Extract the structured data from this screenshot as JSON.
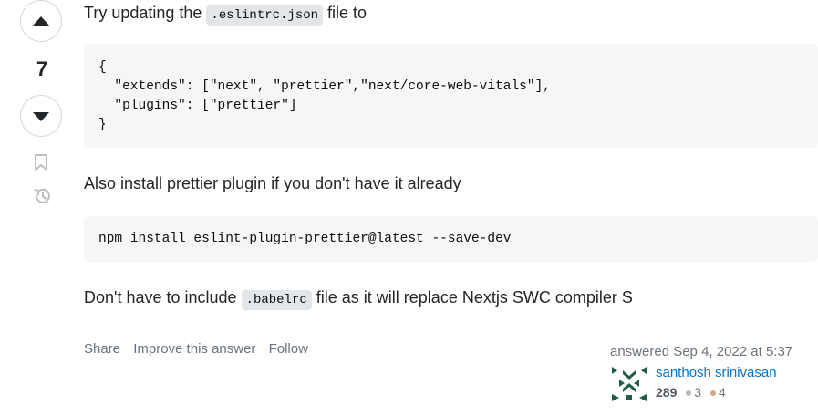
{
  "vote": {
    "count": "7",
    "up_icon": "arrow-up-icon",
    "down_icon": "arrow-down-icon",
    "bookmark_icon": "bookmark-icon",
    "history_icon": "history-icon"
  },
  "post": {
    "p1_before": "Try updating the ",
    "p1_code": ".eslintrc.json",
    "p1_after": " file to",
    "code1": "{\n  \"extends\": [\"next\", \"prettier\",\"next/core-web-vitals\"],\n  \"plugins\": [\"prettier\"]\n}",
    "p2": "Also install prettier plugin if you don't have it already",
    "code2": "npm install eslint-plugin-prettier@latest --save-dev",
    "p3_before": "Don't have to include ",
    "p3_code": ".babelrc",
    "p3_after": " file as it will replace Nextjs SWC compiler S"
  },
  "actions": {
    "share": "Share",
    "improve": "Improve this answer",
    "follow": "Follow"
  },
  "signature": {
    "answered": "answered Sep 4, 2022 at 5:37",
    "user_name": "santhosh srinivasan",
    "reputation": "289",
    "silver_badges": "3",
    "bronze_badges": "4",
    "silver_color": "#b4b8bc",
    "bronze_color": "#d1a684",
    "avatar_color": "#1f5c4a"
  }
}
